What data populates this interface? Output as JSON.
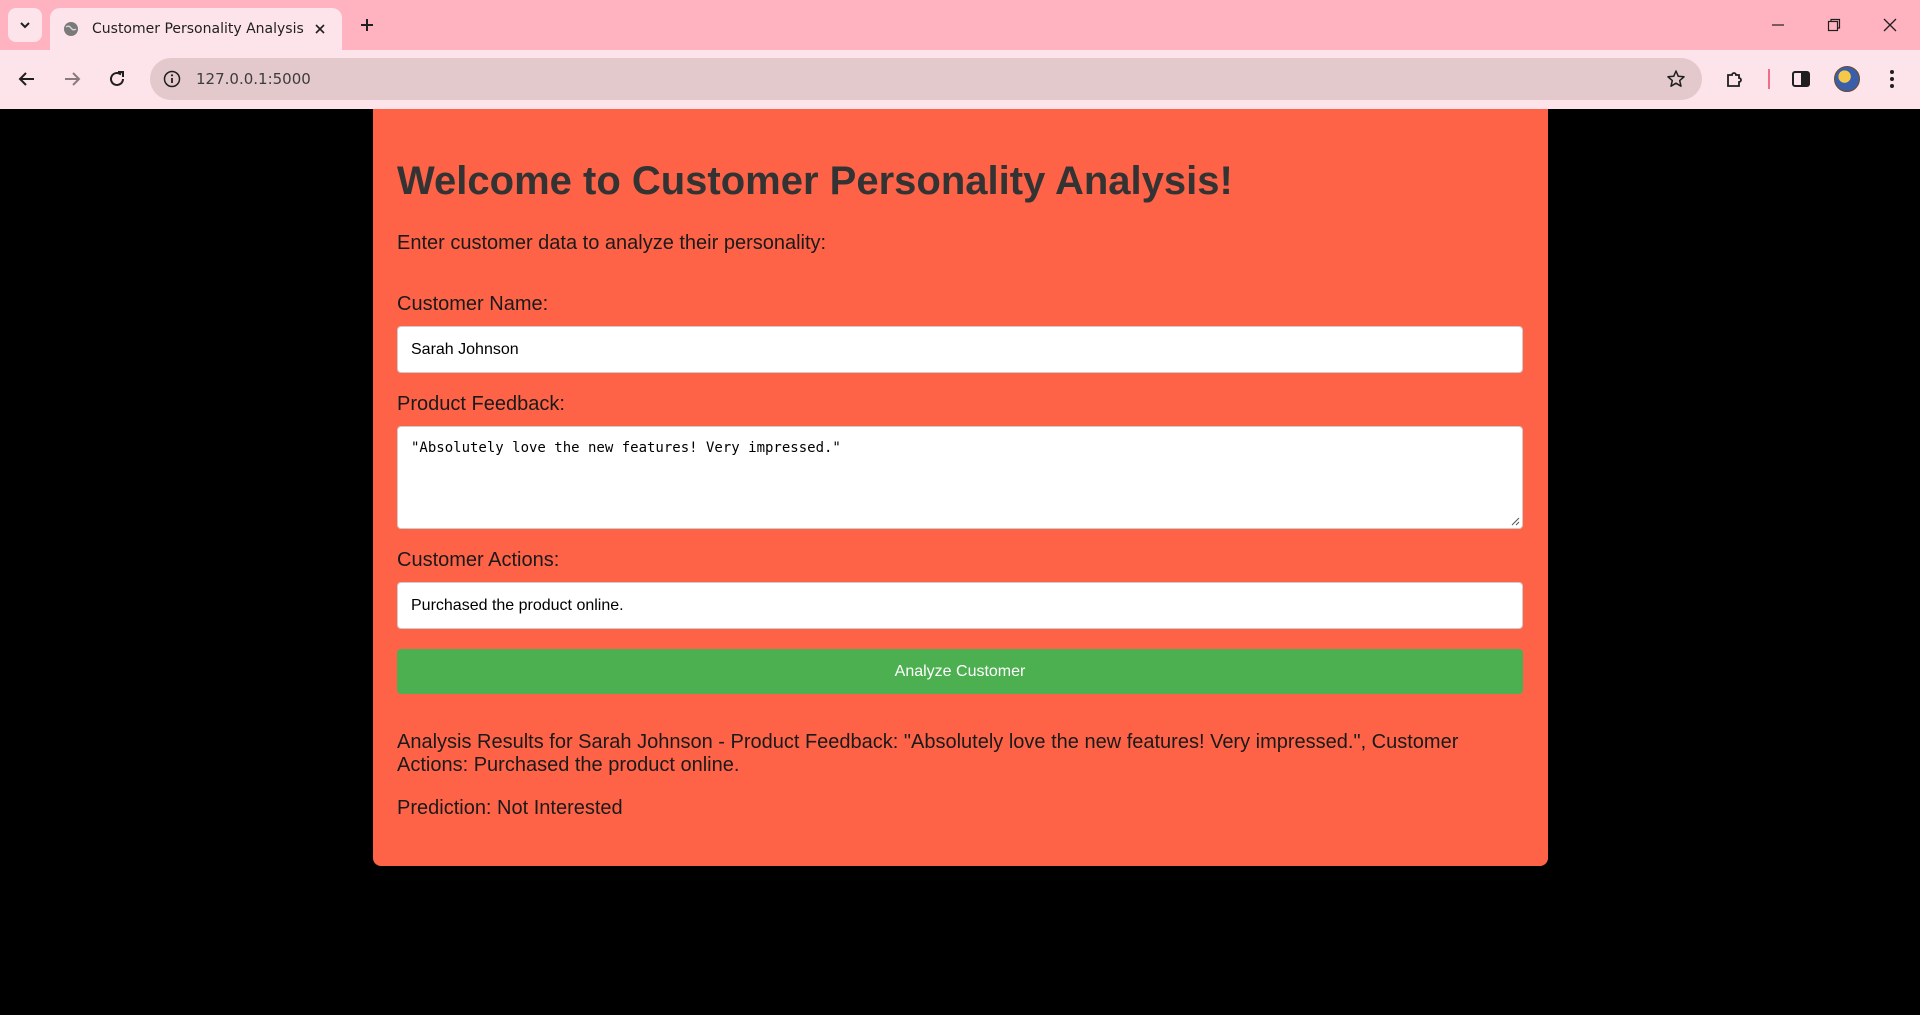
{
  "browser": {
    "tab_title": "Customer Personality Analysis",
    "url": "127.0.0.1:5000",
    "icons": {
      "tab_search": "chevron-down-icon",
      "favicon": "globe-icon",
      "close_tab": "close-icon",
      "new_tab": "plus-icon",
      "minimize": "minimize-icon",
      "restore": "restore-icon",
      "close_window": "close-icon",
      "back": "arrow-left-icon",
      "forward": "arrow-right-icon",
      "reload": "reload-icon",
      "site_info": "info-icon",
      "bookmark": "star-icon",
      "extensions": "puzzle-icon",
      "side_panel": "side-panel-icon",
      "profile": "avatar",
      "menu": "kebab-menu-icon"
    }
  },
  "page": {
    "heading": "Welcome to Customer Personality Analysis!",
    "intro": "Enter customer data to analyze their personality:",
    "form": {
      "name_label": "Customer Name:",
      "name_value": "Sarah Johnson",
      "feedback_label": "Product Feedback:",
      "feedback_value": "\"Absolutely love the new features! Very impressed.\"",
      "actions_label": "Customer Actions:",
      "actions_value": "Purchased the product online.",
      "submit_label": "Analyze Customer"
    },
    "result_text": "Analysis Results for Sarah Johnson - Product Feedback: \"Absolutely love the new features! Very impressed.\", Customer Actions: Purchased the product online.",
    "prediction_text": "Prediction: Not Interested"
  },
  "colors": {
    "tabstrip": "#ffb3c1",
    "toolbar": "#fde4ea",
    "page_background": "#000000",
    "card": "#ff6347",
    "button": "#4caf50",
    "heading": "#333333"
  }
}
